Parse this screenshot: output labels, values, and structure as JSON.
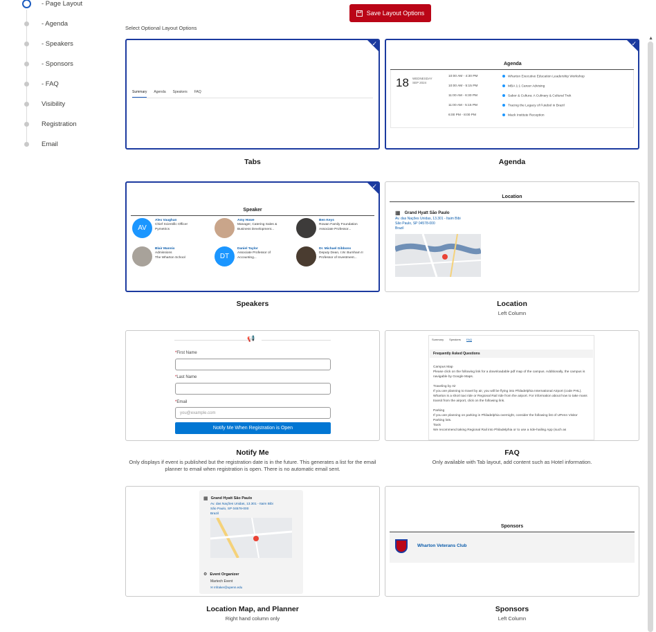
{
  "nav": {
    "steps": [
      {
        "label": "- Page Layout",
        "active": true
      },
      {
        "label": "- Agenda"
      },
      {
        "label": "- Speakers"
      },
      {
        "label": "- Sponsors"
      },
      {
        "label": "- FAQ"
      },
      {
        "label": "Visibility"
      },
      {
        "label": "Registration"
      },
      {
        "label": "Email"
      }
    ]
  },
  "toolbar": {
    "save_label": "Save Layout Options"
  },
  "intro": {
    "select_label": "Select Optional Layout Options"
  },
  "cards": {
    "tabs": {
      "title": "Tabs",
      "selected": true,
      "tabs": [
        "Summary",
        "Agenda",
        "Speakers",
        "FAQ"
      ]
    },
    "agenda": {
      "title": "Agenda",
      "selected": true,
      "preview_title": "Agenda",
      "day": "18",
      "weekday": "WEDNESDAY",
      "month_year": "SEP 2024",
      "rows": [
        {
          "time": "10:00 AM - 4:30 PM",
          "event": "Wharton Executive Education Leadership Workshop"
        },
        {
          "time": "10:00 AM - 5:15 PM",
          "event": "MBA 1:1 Career Advising"
        },
        {
          "time": "11:00 AM - 6:30 PM",
          "event": "Sabor & Cultura: A Culinary & Cultural Trek"
        },
        {
          "time": "11:00 AM - 5:15 PM",
          "event": "Tracing the Legacy of Futebol in Brazil"
        },
        {
          "time": "6:00 PM - 8:00 PM",
          "event": "Mack Institute Reception"
        }
      ]
    },
    "speakers": {
      "title": "Speakers",
      "selected": true,
      "preview_title": "Speaker",
      "people": [
        {
          "initials": "AV",
          "name": "Alex Vaughan",
          "role1": "Chief Scientific Officer",
          "role2": "Pymetrics"
        },
        {
          "initials": "",
          "name": "Amy Howe",
          "role1": "Manager, Catering Sales &",
          "role2": "Business Development..."
        },
        {
          "initials": "",
          "name": "Ben Keys",
          "role1": "Rowan Family Foundation",
          "role2": "Associate Professor..."
        },
        {
          "initials": "",
          "name": "Blair Mannix",
          "role1": "Admissions",
          "role2": "The Wharton School"
        },
        {
          "initials": "DT",
          "name": "Daniel Taylor",
          "role1": "Associate Professor of",
          "role2": "Accounting..."
        },
        {
          "initials": "",
          "name": "Dr. Michael Gibbons",
          "role1": "Deputy Dean, I.W. Burnham II",
          "role2": "Professor of Investment..."
        }
      ]
    },
    "location": {
      "title": "Location",
      "subtitle": "Left Column",
      "preview_title": "Location",
      "venue": "Grand Hyatt São Paulo",
      "address1": "Av. das Nações Unidas, 13.301 - Itaim Bibi",
      "address2": "São Paulo, SP 04578-000",
      "address3": "Brazil"
    },
    "notify": {
      "title": "Notify Me",
      "subtitle": "Only displays if event is published but the registration date is in the future. This generates a list for the email planner to email when registration is open. There is no automatic email sent.",
      "first_label": "First Name",
      "last_label": "Last Name",
      "email_label": "Email",
      "email_placeholder": "you@example.com",
      "button_label": "Notify Me When Registration is Open"
    },
    "faq": {
      "title": "FAQ",
      "subtitle": "Only available with Tab layout, add content such as Hotel information.",
      "tabs": [
        "Summary",
        "Speakers",
        "FAQ"
      ],
      "heading": "Frequently Asked Questions",
      "body": [
        "Campus Map",
        "Please click on the following link for a downloadable pdf map of the campus. Additionally, the campus is navigable by Google Maps.",
        "",
        "Traveling by Air",
        "If you are planning to travel by air, you will be flying into Philadelphia International Airport (code PHL). Wharton is a short taxi ride or Regional Rail ride from the airport. For information about how to take mass transit from the airport, click on the following link.",
        "",
        "Parking",
        "If you are planning on parking in Philadelphia overnight, consider the following list of UPenn Visitor Parking lots.",
        "Taxis",
        "We recommend taking Regional Rail into Philadelphia or to use a ride-hailing App (such as"
      ]
    },
    "map_planner": {
      "title": "Location Map, and Planner",
      "subtitle": "Right hand column only",
      "venue": "Grand Hyatt São Paulo",
      "address1": "Av. das Nações Unidas, 13.301 - Itaim Bibi",
      "address2": "São Paulo, SP 04578-000",
      "address3": "Brazil",
      "organizer_label": "Event Organizer",
      "organizer_name": "Martech Event",
      "organizer_email": "mfraker@upenn.edu"
    },
    "sponsors": {
      "title": "Sponsors",
      "subtitle": "Left Column",
      "preview_title": "Sponsors",
      "sponsor_name": "Wharton Veterans Club"
    }
  },
  "colors": {
    "accent": "#1b3a9f",
    "save": "#ba0517",
    "link": "#0b5cab",
    "button": "#0176d3"
  }
}
